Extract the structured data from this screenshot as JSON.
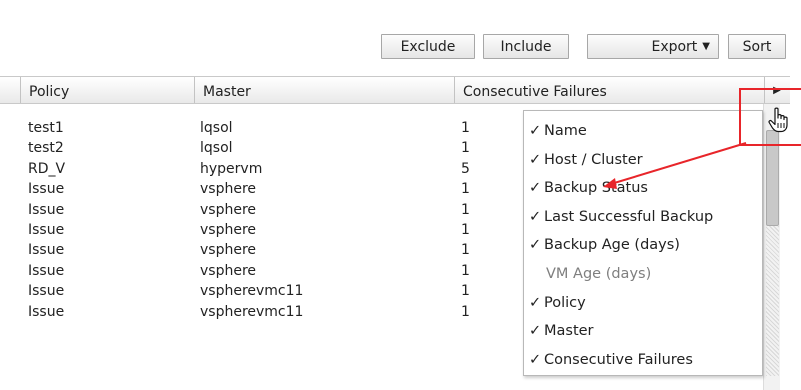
{
  "toolbar": {
    "exclude": "Exclude",
    "include": "Include",
    "export": "Export",
    "sort": "Sort"
  },
  "columns": [
    "Policy",
    "Master",
    "Consecutive Failures"
  ],
  "rows": [
    {
      "policy": "test1",
      "master": "lqsol",
      "failures": "1"
    },
    {
      "policy": "test2",
      "master": "lqsol",
      "failures": "1"
    },
    {
      "policy": "RD_V",
      "master": "hypervm",
      "failures": "5"
    },
    {
      "policy": "Issue",
      "master": "vsphere",
      "failures": "1"
    },
    {
      "policy": "Issue",
      "master": "vsphere",
      "failures": "1"
    },
    {
      "policy": "Issue",
      "master": "vsphere",
      "failures": "1"
    },
    {
      "policy": "Issue",
      "master": "vsphere",
      "failures": "1"
    },
    {
      "policy": "Issue",
      "master": "vsphere",
      "failures": "1"
    },
    {
      "policy": "Issue",
      "master": "vspherevmc11",
      "failures": "1"
    },
    {
      "policy": "Issue",
      "master": "vspherevmc11",
      "failures": "1"
    }
  ],
  "column_menu": {
    "check_glyph": "✓",
    "items": [
      {
        "label": "Name",
        "checked": true
      },
      {
        "label": "Host / Cluster",
        "checked": true
      },
      {
        "label": "Backup Status",
        "checked": true
      },
      {
        "label": "Last Successful Backup",
        "checked": true
      },
      {
        "label": "Backup Age (days)",
        "checked": true
      },
      {
        "label": "VM Age (days)",
        "checked": false
      },
      {
        "label": "Policy",
        "checked": true
      },
      {
        "label": "Master",
        "checked": true
      },
      {
        "label": "Consecutive Failures",
        "checked": true
      }
    ]
  },
  "colors": {
    "annotation": "#e8252a",
    "disabled_text": "#7f7f7f"
  }
}
